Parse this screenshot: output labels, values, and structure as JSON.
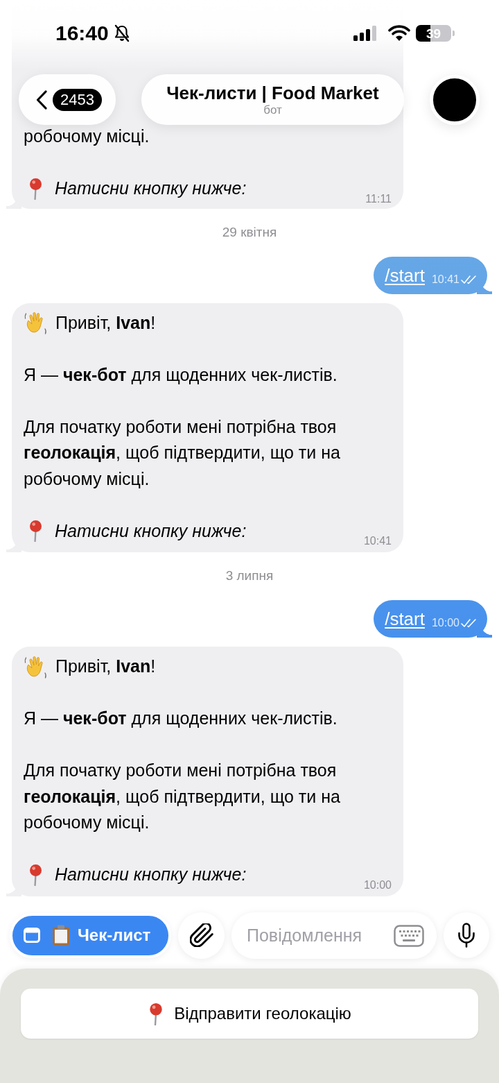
{
  "status_bar": {
    "time": "16:40",
    "battery": "39"
  },
  "header": {
    "back_count": "2453",
    "title": "Чек-листи | Food Market",
    "subtitle": "бот"
  },
  "messages": [
    {
      "kind": "incoming",
      "clipped_top": true,
      "paragraphs": [
        {
          "kind": "plain",
          "text": "робочому місці."
        },
        {
          "kind": "pin",
          "text": "Натисни кнопку нижче:"
        }
      ],
      "time": "11:11"
    },
    {
      "kind": "date",
      "text": "29 квітня"
    },
    {
      "kind": "outgoing",
      "text": "/start",
      "time": "10:41",
      "read": true
    },
    {
      "kind": "incoming",
      "clipped_top": false,
      "paragraphs": [
        {
          "kind": "wave",
          "text": "Привіт, **Ivan**!"
        },
        {
          "kind": "plain",
          "text": "Я — **чек-бот** для щоденних чек-листів."
        },
        {
          "kind": "plain",
          "text": "Для початку роботи мені потрібна твоя **геолокація**, щоб підтвердити, що ти на робочому місці."
        },
        {
          "kind": "pin",
          "text": "Натисни кнопку нижче:"
        }
      ],
      "time": "10:41"
    },
    {
      "kind": "date",
      "text": "3 липня"
    },
    {
      "kind": "outgoing",
      "text": "/start",
      "time": "10:00",
      "read": true
    },
    {
      "kind": "incoming",
      "clipped_top": false,
      "paragraphs": [
        {
          "kind": "wave",
          "text": "Привіт, **Ivan**!"
        },
        {
          "kind": "plain",
          "text": "Я — **чек-бот** для щоденних чек-листів."
        },
        {
          "kind": "plain",
          "text": "Для початку роботи мені потрібна твоя **геолокація**, щоб підтвердити, що ти на робочому місці."
        },
        {
          "kind": "pin",
          "text": "Натисни кнопку нижче:"
        }
      ],
      "time": "10:00"
    }
  ],
  "composer": {
    "menu_button": "Чек-лист",
    "placeholder": "Повідомлення"
  },
  "reply_keyboard": {
    "buttons": [
      {
        "kind": "location",
        "label": "Відправити геолокацію"
      }
    ]
  }
}
